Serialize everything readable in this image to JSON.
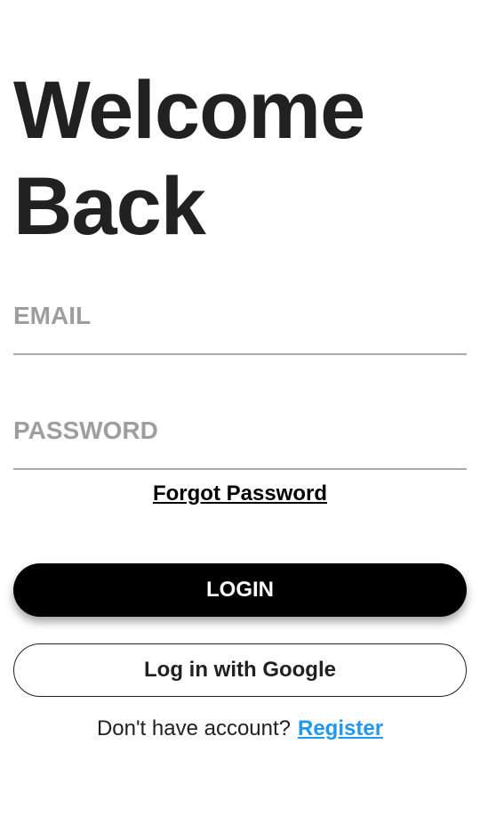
{
  "header": {
    "title_line1": "Welcome",
    "title_line2": "Back"
  },
  "form": {
    "email_placeholder": "EMAIL",
    "email_value": "",
    "password_placeholder": "PASSWORD",
    "password_value": "",
    "forgot_label": "Forgot Password"
  },
  "actions": {
    "login_label": "LOGIN",
    "google_label": "Log in with Google"
  },
  "footer": {
    "prompt": "Don't have account?",
    "register_label": "Register"
  },
  "colors": {
    "primary": "#000000",
    "link": "#2196f3",
    "placeholder": "#9e9e9e",
    "text": "#212121"
  }
}
